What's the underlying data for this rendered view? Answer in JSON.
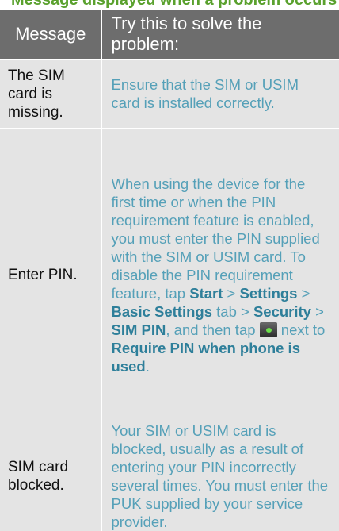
{
  "heading_fragment": "Message displayed when a problem occurs",
  "table": {
    "headers": {
      "message": "Message",
      "solution": "Try this to solve the problem:"
    },
    "rows": [
      {
        "message": "The SIM card is missing.",
        "solution": "Ensure that the SIM or USIM card is installed correctly."
      },
      {
        "message": "Enter PIN.",
        "solution_parts": {
          "intro": "When using the device for the first time or when the PIN requirement feature is enabled, you must enter the PIN supplied with the SIM or USIM card. To disable the PIN requirement feature, tap ",
          "start": "Start",
          "sep1": " > ",
          "settings": "Settings",
          "sep2": " > ",
          "basic_settings": "Basic Settings",
          "tab_word": " tab > ",
          "security": "Security",
          "sep3": " > ",
          "sim_pin": "SIM PIN",
          "and_then_tap": ", and then tap ",
          "next_to": " next to ",
          "require_pin": "Require PIN when phone is used",
          "end": "."
        },
        "toggle_icon": "checkbox-toggle-icon"
      },
      {
        "message": "SIM card blocked.",
        "solution": "Your SIM or USIM card is blocked, usually as a result of entering your PIN incorrectly several times. You must enter the PUK supplied by your service provider."
      }
    ]
  }
}
